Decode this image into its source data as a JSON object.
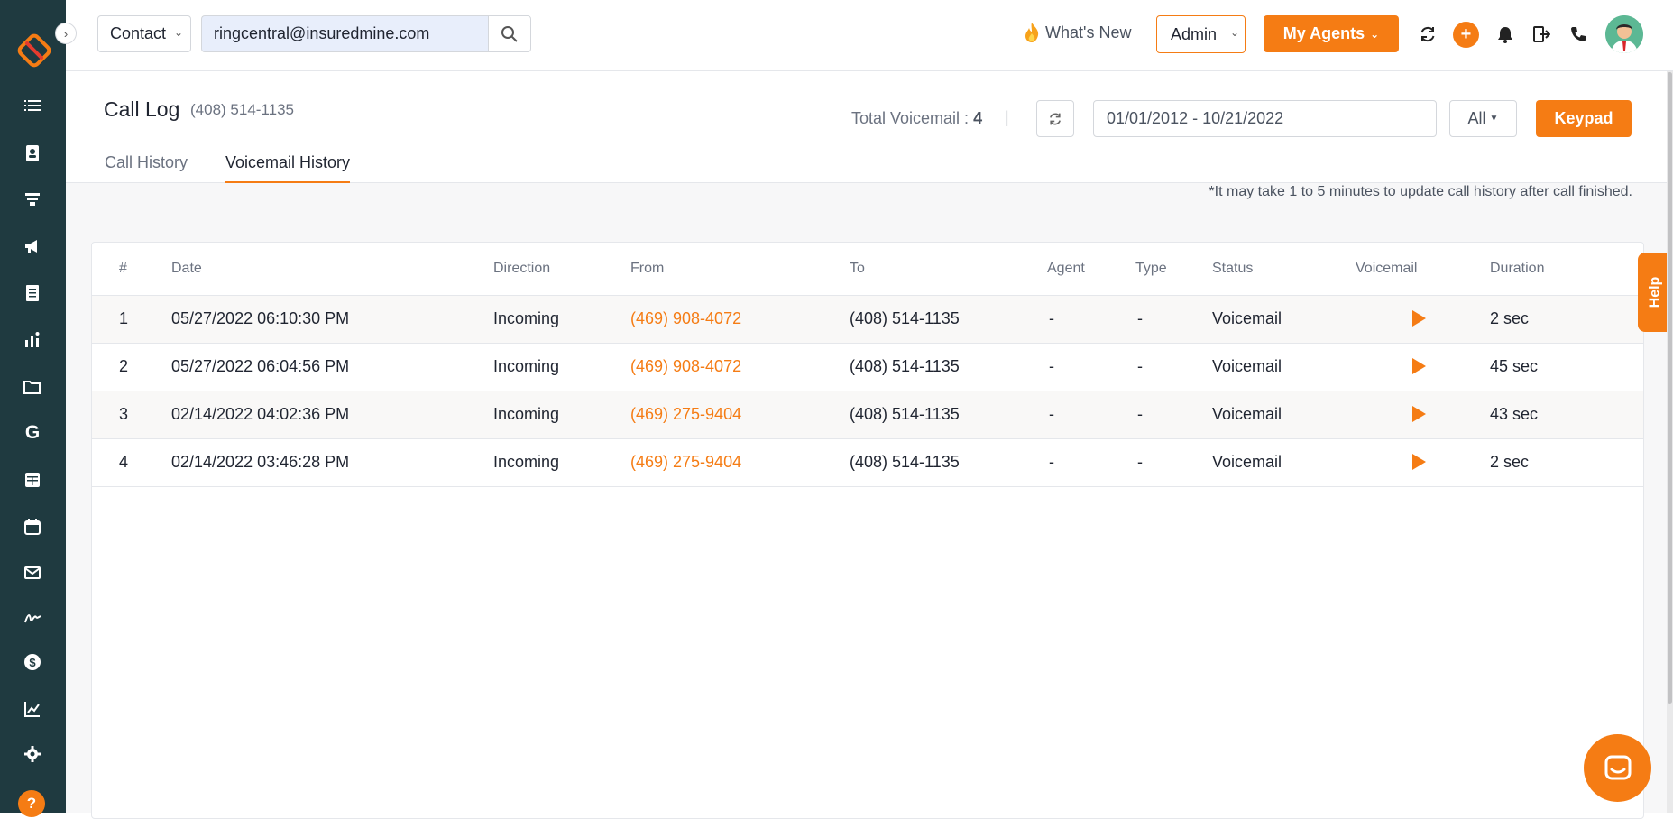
{
  "sidebar": {
    "items": [
      {
        "name": "list-icon"
      },
      {
        "name": "contacts-icon"
      },
      {
        "name": "funnel-icon"
      },
      {
        "name": "megaphone-icon"
      },
      {
        "name": "document-icon"
      },
      {
        "name": "bar-chart-icon"
      },
      {
        "name": "folder-icon"
      },
      {
        "name": "google-icon"
      },
      {
        "name": "table-icon"
      },
      {
        "name": "calendar-icon"
      },
      {
        "name": "mail-icon"
      },
      {
        "name": "signature-icon"
      },
      {
        "name": "dollar-icon"
      },
      {
        "name": "line-chart-icon"
      },
      {
        "name": "gear-icon"
      }
    ],
    "help_label": "?"
  },
  "topbar": {
    "contact_select": "Contact",
    "search_value": "ringcentral@insuredmine.com",
    "whats_new": "What's New",
    "admin_select": "Admin",
    "my_agents": "My Agents",
    "plus": "+"
  },
  "page": {
    "title": "Call Log",
    "subtitle": "(408) 514-1135",
    "total_voicemail_label": "Total Voicemail :",
    "total_voicemail_count": "4",
    "separator": "|",
    "date_range": "01/01/2012 - 10/21/2022",
    "filter": "All",
    "keypad": "Keypad",
    "note": "*It may take 1 to 5 minutes to update call history after call finished."
  },
  "tabs": [
    {
      "label": "Call History",
      "active": false
    },
    {
      "label": "Voicemail History",
      "active": true
    }
  ],
  "table": {
    "headers": [
      "#",
      "Date",
      "Direction",
      "From",
      "To",
      "Agent",
      "Type",
      "Status",
      "Voicemail",
      "Duration"
    ],
    "rows": [
      {
        "num": "1",
        "date": "05/27/2022 06:10:30 PM",
        "direction": "Incoming",
        "from": "(469) 908-4072",
        "to": "(408) 514-1135",
        "agent": "-",
        "type": "-",
        "status": "Voicemail",
        "duration": "2 sec"
      },
      {
        "num": "2",
        "date": "05/27/2022 06:04:56 PM",
        "direction": "Incoming",
        "from": "(469) 908-4072",
        "to": "(408) 514-1135",
        "agent": "-",
        "type": "-",
        "status": "Voicemail",
        "duration": "45 sec"
      },
      {
        "num": "3",
        "date": "02/14/2022 04:02:36 PM",
        "direction": "Incoming",
        "from": "(469) 275-9404",
        "to": "(408) 514-1135",
        "agent": "-",
        "type": "-",
        "status": "Voicemail",
        "duration": "43 sec"
      },
      {
        "num": "4",
        "date": "02/14/2022 03:46:28 PM",
        "direction": "Incoming",
        "from": "(469) 275-9404",
        "to": "(408) 514-1135",
        "agent": "-",
        "type": "-",
        "status": "Voicemail",
        "duration": "2 sec"
      }
    ]
  },
  "help_tab": "Help",
  "colors": {
    "accent": "#f57c14",
    "sidebar": "#1f3a40"
  }
}
